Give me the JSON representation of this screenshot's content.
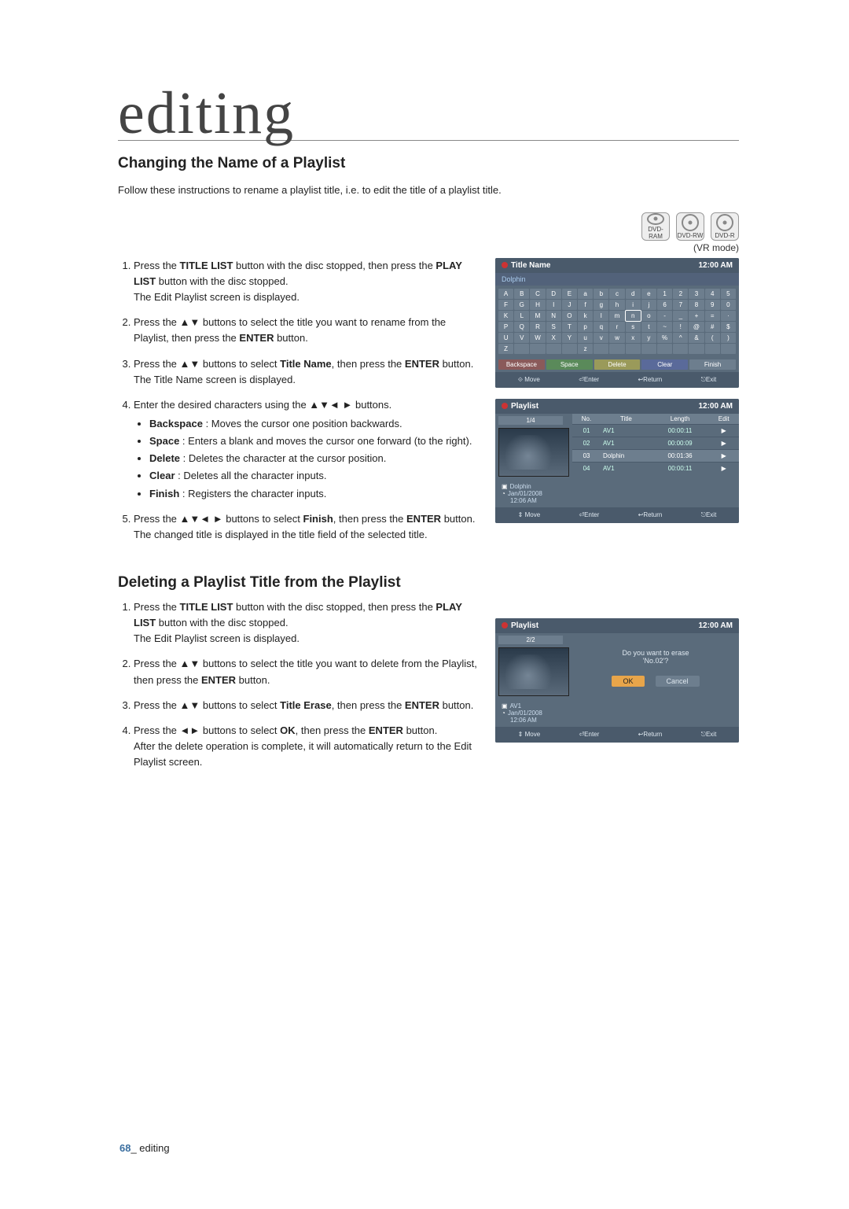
{
  "page_title": "editing",
  "footer": {
    "page_num": "68",
    "label": "_ editing"
  },
  "discs": [
    "DVD-RAM",
    "DVD-RW",
    "DVD-R"
  ],
  "mode_note": "(VR mode)",
  "sectionA": {
    "title": "Changing the Name of a Playlist",
    "intro": "Follow these instructions to rename a playlist title, i.e. to edit the title of a playlist title.",
    "steps": [
      {
        "pre": "Press the ",
        "b1": "TITLE LIST",
        "mid1": " button with the disc stopped, then press the ",
        "b2": "PLAY LIST",
        "post": " button with the disc stopped.",
        "tail": "The Edit Playlist screen is displayed."
      },
      {
        "pre": "Press the ▲▼ buttons to select the title you want to rename from the Playlist, then press the ",
        "b1": "ENTER",
        "post": " button."
      },
      {
        "pre": "Press the ▲▼ buttons to select ",
        "b1": "Title Name",
        "mid1": ", then press the ",
        "b2": "ENTER",
        "post": " button.",
        "tail": "The Title Name screen is displayed."
      },
      {
        "pre": "Enter the desired characters using the ▲▼◄ ► buttons.",
        "bullets": [
          {
            "b": "Backspace",
            "t": " : Moves the cursor one position backwards."
          },
          {
            "b": "Space",
            "t": " : Enters a blank and moves the cursor one forward (to the right)."
          },
          {
            "b": "Delete",
            "t": " : Deletes the character at the cursor position."
          },
          {
            "b": "Clear",
            "t": " : Deletes all the character inputs."
          },
          {
            "b": "Finish",
            "t": " : Registers the character inputs."
          }
        ]
      },
      {
        "pre": "Press the ▲▼◄ ► buttons to select ",
        "b1": "Finish",
        "mid1": ", then press the ",
        "b2": "ENTER",
        "post": " button.",
        "tail": "The changed title is displayed in the title field of the selected title."
      }
    ]
  },
  "sectionB": {
    "title": "Deleting a Playlist Title from the Playlist",
    "steps": [
      {
        "pre": "Press the ",
        "b1": "TITLE LIST",
        "mid1": " button with the disc stopped, then press the ",
        "b2": "PLAY LIST",
        "post": " button with the disc stopped.",
        "tail": "The Edit Playlist screen is displayed."
      },
      {
        "pre": "Press the ▲▼ buttons to select the title you want to delete from the Playlist, then press the ",
        "b1": "ENTER",
        "post": " button."
      },
      {
        "pre": "Press the ▲▼ buttons to select ",
        "b1": "Title Erase",
        "mid1": ", then press the ",
        "b2": "ENTER",
        "post": " button."
      },
      {
        "pre": "Press the ◄► buttons to select ",
        "b1": "OK",
        "mid1": ", then press the ",
        "b2": "ENTER",
        "post": " button.",
        "tail": "After the delete operation is complete, it will automatically return to the Edit Playlist screen."
      }
    ]
  },
  "ui_keyboard": {
    "header_title": "Title Name",
    "header_time": "12:00 AM",
    "sub": "Dolphin",
    "keys": [
      "A",
      "B",
      "C",
      "D",
      "E",
      "a",
      "b",
      "c",
      "d",
      "e",
      "1",
      "2",
      "3",
      "4",
      "5",
      "F",
      "G",
      "H",
      "I",
      "J",
      "f",
      "g",
      "h",
      "i",
      "j",
      "6",
      "7",
      "8",
      "9",
      "0",
      "K",
      "L",
      "M",
      "N",
      "O",
      "k",
      "l",
      "m",
      "n",
      "o",
      "-",
      "_",
      "+",
      "=",
      "·",
      "P",
      "Q",
      "R",
      "S",
      "T",
      "p",
      "q",
      "r",
      "s",
      "t",
      "~",
      "!",
      "@",
      "#",
      "$",
      "U",
      "V",
      "W",
      "X",
      "Y",
      "u",
      "v",
      "w",
      "x",
      "y",
      "%",
      "^",
      "&",
      "(",
      ")",
      "Z",
      "",
      "",
      "",
      "",
      "z",
      "",
      "",
      "",
      "",
      "",
      "",
      "",
      "",
      ""
    ],
    "fns": [
      "Backspace",
      "Space",
      "Delete",
      "Clear",
      "Finish"
    ],
    "footer": [
      "⟐ Move",
      "⏎Enter",
      "↩Return",
      "⎋Exit"
    ]
  },
  "ui_playlist": {
    "header_title": "Playlist",
    "header_time": "12:00 AM",
    "count": "1/4",
    "side": {
      "name": "Dolphin",
      "date": "Jan/01/2008",
      "time": "12:06 AM"
    },
    "cols": [
      "No.",
      "Title",
      "Length",
      "Edit"
    ],
    "rows": [
      {
        "no": "01",
        "title": "AV1",
        "len": "00:00:11"
      },
      {
        "no": "02",
        "title": "AV1",
        "len": "00:00:09"
      },
      {
        "no": "03",
        "title": "Dolphin",
        "len": "00:01:36"
      },
      {
        "no": "04",
        "title": "AV1",
        "len": "00:00:11"
      }
    ],
    "footer": [
      "⇕ Move",
      "⏎Enter",
      "↩Return",
      "⎋Exit"
    ]
  },
  "ui_dialog": {
    "header_title": "Playlist",
    "header_time": "12:00 AM",
    "count": "2/2",
    "side": {
      "name": "AV1",
      "date": "Jan/01/2008",
      "time": "12:06 AM"
    },
    "question1": "Do you want to erase",
    "question2": "'No.02'?",
    "ok": "OK",
    "cancel": "Cancel",
    "footer": [
      "⇕ Move",
      "⏎Enter",
      "↩Return",
      "⎋Exit"
    ]
  }
}
